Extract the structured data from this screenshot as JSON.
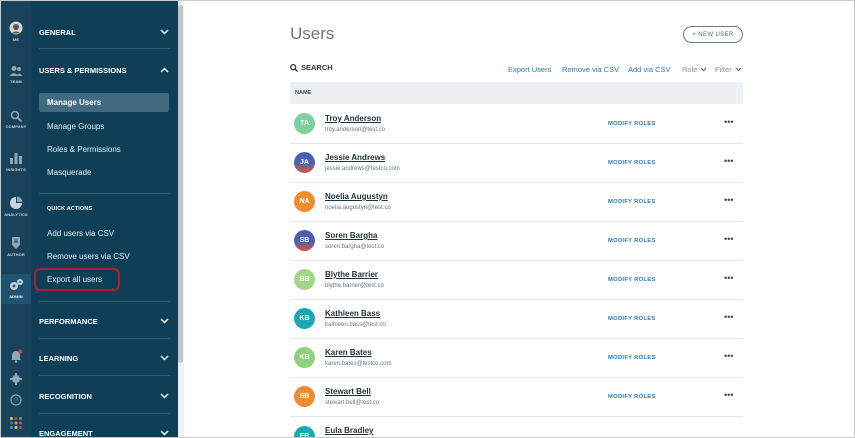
{
  "rail": {
    "items": [
      {
        "label": "ME",
        "icon": "user-avatar-icon"
      },
      {
        "label": "TEAM",
        "icon": "team-icon"
      },
      {
        "label": "COMPANY",
        "icon": "company-search-icon"
      },
      {
        "label": "INSIGHTS",
        "icon": "bar-chart-icon"
      },
      {
        "label": "ANALYTICS",
        "icon": "analytics-icon"
      },
      {
        "label": "AUTHOR",
        "icon": "author-icon"
      },
      {
        "label": "ADMIN",
        "icon": "gears-icon"
      }
    ]
  },
  "sidebar": {
    "general": "GENERAL",
    "users_permissions": "USERS & PERMISSIONS",
    "items": [
      "Manage Users",
      "Manage Groups",
      "Roles & Permissions",
      "Masquerade"
    ],
    "quick_actions": "QUICK ACTIONS",
    "quick_items": [
      "Add users via CSV",
      "Remove users via CSV",
      "Export all users"
    ],
    "performance": "PERFORMANCE",
    "learning": "LEARNING",
    "recognition": "RECOGNITION",
    "engagement": "ENGAGEMENT"
  },
  "main": {
    "title": "Users",
    "new_user": "+ NEW USER",
    "search": "SEARCH",
    "export_users": "Export Users",
    "remove_csv": "Remove via CSV",
    "add_csv": "Add via CSV",
    "role": "Role",
    "filter": "Filter",
    "column_name": "NAME",
    "modify_roles": "MODIFY ROLES",
    "more": "•••"
  },
  "users": [
    {
      "initials": "TA",
      "name": "Troy Anderson",
      "email": "troy.anderson@test.co",
      "color": "#7dd1a0"
    },
    {
      "initials": "JA",
      "name": "Jessie Andrews",
      "email": "jessie.andrews@testco.com",
      "color": "#4a5fb4"
    },
    {
      "initials": "NA",
      "name": "Noelia Augustyn",
      "email": "noelia.augustyn@test.co",
      "color": "#f28a2e"
    },
    {
      "initials": "SB",
      "name": "Soren Bargha",
      "email": "soren.bargha@test.co",
      "color": "#4a5fb4"
    },
    {
      "initials": "BB",
      "name": "Blythe Barrier",
      "email": "blythe.barrier@test.co",
      "color": "#a2d68a"
    },
    {
      "initials": "KB",
      "name": "Kathleen Bass",
      "email": "kathleen.bass@test.co",
      "color": "#1ba8b5"
    },
    {
      "initials": "KB",
      "name": "Karen Bates",
      "email": "karen.bates@testco.com",
      "color": "#8cd37c"
    },
    {
      "initials": "SB",
      "name": "Stewart Bell",
      "email": "stewart.bell@test.co",
      "color": "#f08a2e"
    },
    {
      "initials": "EB",
      "name": "Eula Bradley",
      "email": "",
      "color": "#1ba8b5"
    }
  ],
  "colors": {
    "rail_bg": "#18425a",
    "panel_bg": "#0f3f57",
    "link_blue": "#2a7bb5",
    "highlight_red": "#b81c2a"
  }
}
